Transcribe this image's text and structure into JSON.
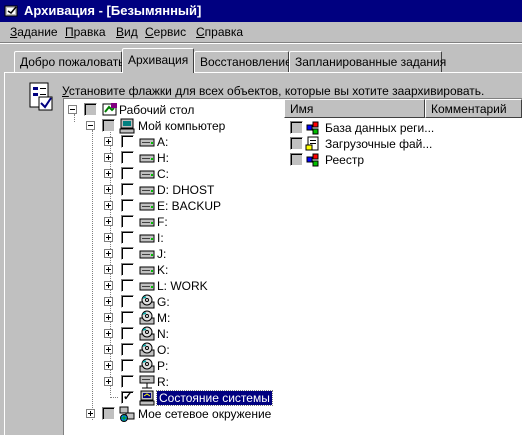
{
  "window": {
    "title": "Архивация - [Безымянный]"
  },
  "menu": [
    "Задание",
    "Правка",
    "Вид",
    "Сервис",
    "Справка"
  ],
  "tabs": [
    "Добро пожаловать!",
    "Архивация",
    "Восстановление",
    "Запланированные задания"
  ],
  "active_tab": "Архивация",
  "instruction": "Установите флажки для всех объектов, которые вы хотите заархивировать.",
  "tree": [
    {
      "label": "Рабочий стол",
      "icon": "desktop-icon",
      "level": 0,
      "expander": "minus",
      "checked": false
    },
    {
      "label": "Мой компьютер",
      "icon": "computer-icon",
      "level": 1,
      "expander": "minus",
      "checked": false
    },
    {
      "label": "A:",
      "icon": "floppy-drive-icon",
      "level": 2,
      "expander": "plus",
      "checked": false
    },
    {
      "label": "H:",
      "icon": "disk-drive-icon",
      "level": 2,
      "expander": "plus",
      "checked": false
    },
    {
      "label": "C:",
      "icon": "disk-drive-icon",
      "level": 2,
      "expander": "plus",
      "checked": false
    },
    {
      "label": "D: DHOST",
      "icon": "disk-drive-icon",
      "level": 2,
      "expander": "plus",
      "checked": false
    },
    {
      "label": "E: BACKUP",
      "icon": "disk-drive-icon",
      "level": 2,
      "expander": "plus",
      "checked": false
    },
    {
      "label": "F:",
      "icon": "disk-drive-icon",
      "level": 2,
      "expander": "plus",
      "checked": false
    },
    {
      "label": "I:",
      "icon": "disk-drive-icon",
      "level": 2,
      "expander": "plus",
      "checked": false
    },
    {
      "label": "J:",
      "icon": "disk-drive-icon",
      "level": 2,
      "expander": "plus",
      "checked": false
    },
    {
      "label": "K:",
      "icon": "disk-drive-icon",
      "level": 2,
      "expander": "plus",
      "checked": false
    },
    {
      "label": "L: WORK",
      "icon": "disk-drive-icon",
      "level": 2,
      "expander": "plus",
      "checked": false
    },
    {
      "label": "G:",
      "icon": "cd-drive-icon",
      "level": 2,
      "expander": "plus",
      "checked": false
    },
    {
      "label": "M:",
      "icon": "cd-drive-icon",
      "level": 2,
      "expander": "plus",
      "checked": false
    },
    {
      "label": "N:",
      "icon": "cd-drive-icon",
      "level": 2,
      "expander": "plus",
      "checked": false
    },
    {
      "label": "O:",
      "icon": "cd-drive-icon",
      "level": 2,
      "expander": "plus",
      "checked": false
    },
    {
      "label": "P:",
      "icon": "cd-drive-icon",
      "level": 2,
      "expander": "plus",
      "checked": false
    },
    {
      "label": "R:",
      "icon": "network-drive-icon",
      "level": 2,
      "expander": "plus",
      "checked": false
    },
    {
      "label": "Состояние системы",
      "icon": "system-state-icon",
      "level": 2,
      "expander": "none",
      "checked": true,
      "selected": true
    },
    {
      "label": "Мое сетевое окружение",
      "icon": "network-places-icon",
      "level": 1,
      "expander": "plus",
      "checked": false
    }
  ],
  "list": {
    "columns": [
      "Имя",
      "Комментарий"
    ],
    "items": [
      {
        "name": "База данных реги...",
        "icon": "registry-db-icon",
        "checked": false
      },
      {
        "name": "Загрузочные фай...",
        "icon": "boot-files-icon",
        "checked": false
      },
      {
        "name": "Реестр",
        "icon": "registry-icon",
        "checked": false
      }
    ]
  },
  "colors": {
    "titlebar": "#000080",
    "face": "#c0c0c0",
    "selection": "#000080"
  }
}
